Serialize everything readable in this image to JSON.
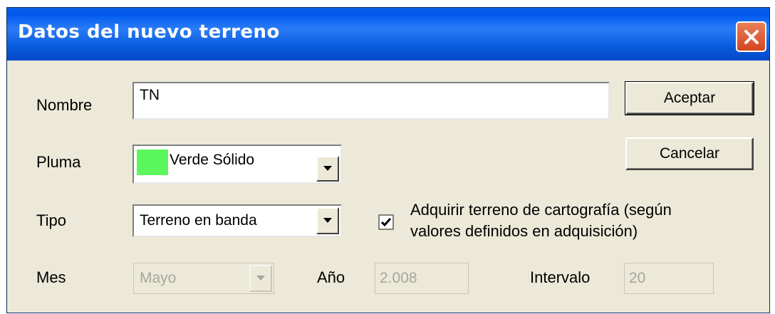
{
  "window": {
    "title": "Datos del nuevo terreno"
  },
  "fields": {
    "nombre": {
      "label": "Nombre",
      "value": "TN"
    },
    "pluma": {
      "label": "Pluma",
      "value": "Verde Sólido",
      "swatch_color": "#5cf75c"
    },
    "tipo": {
      "label": "Tipo",
      "value": "Terreno en banda"
    },
    "mes": {
      "label": "Mes",
      "value": "Mayo"
    },
    "anio": {
      "label": "Año",
      "value": "2.008"
    },
    "intervalo": {
      "label": "Intervalo",
      "value": "20"
    }
  },
  "checkbox": {
    "checked": true,
    "label_line1": "Adquirir terreno de cartografía (según",
    "label_line2": "valores definidos en adquisición)"
  },
  "buttons": {
    "accept": "Aceptar",
    "cancel": "Cancelar"
  },
  "icons": {
    "close": "close-icon",
    "dropdown": "chevron-down-icon",
    "check": "check-icon"
  }
}
